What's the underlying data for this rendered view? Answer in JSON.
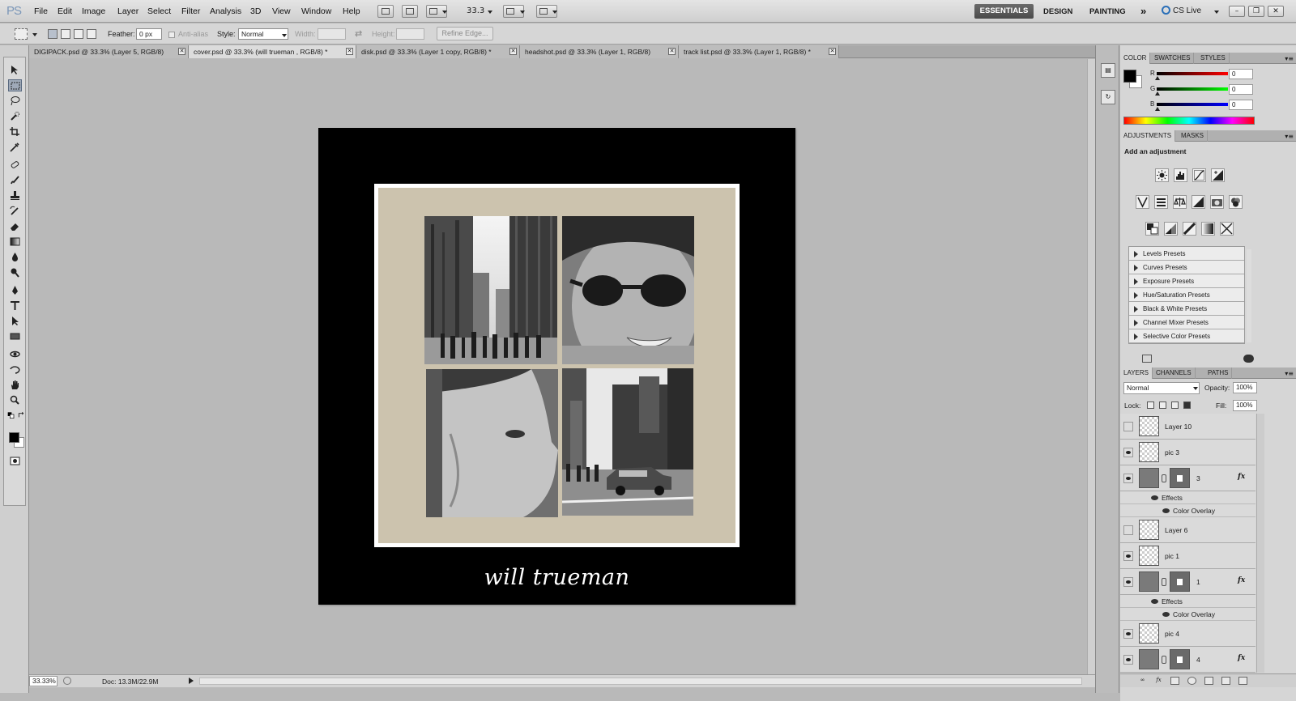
{
  "app": {
    "logo": "PS",
    "menu": [
      "File",
      "Edit",
      "Image",
      "Layer",
      "Select",
      "Filter",
      "Analysis",
      "3D",
      "View",
      "Window",
      "Help"
    ],
    "zoom": "33.3",
    "workspaces": {
      "active": "ESSENTIALS",
      "others": [
        "DESIGN",
        "PAINTING"
      ],
      "more": "»"
    },
    "cs_live": "CS Live"
  },
  "options_bar": {
    "feather_label": "Feather:",
    "feather_value": "0 px",
    "antialias_label": "Anti-alias",
    "style_label": "Style:",
    "style_value": "Normal",
    "width_label": "Width:",
    "height_label": "Height:",
    "refine_edge": "Refine Edge..."
  },
  "tabs": [
    {
      "label": "DIGIPACK.psd @ 33.3% (Layer 5, RGB/8)",
      "active": false
    },
    {
      "label": "cover.psd @ 33.3% (will trueman , RGB/8) *",
      "active": true
    },
    {
      "label": "disk.psd @ 33.3% (Layer 1 copy, RGB/8) *",
      "active": false
    },
    {
      "label": "headshot.psd @ 33.3% (Layer 1, RGB/8)",
      "active": false
    },
    {
      "label": "track list.psd @ 33.3% (Layer 1, RGB/8) *",
      "active": false
    }
  ],
  "document": {
    "title_text": "will trueman",
    "colors": {
      "background": "#000000",
      "frame": "#ffffff",
      "mat": "#ccc3ae"
    }
  },
  "status": {
    "zoom": "33.33%",
    "doc_size": "Doc: 13.3M/22.9M"
  },
  "color_panel": {
    "tabs": [
      "COLOR",
      "SWATCHES",
      "STYLES"
    ],
    "channels": [
      {
        "letter": "R",
        "value": "0",
        "color": "#d00000"
      },
      {
        "letter": "G",
        "value": "0",
        "color": "#00a000"
      },
      {
        "letter": "B",
        "value": "0",
        "color": "#0000d0"
      }
    ]
  },
  "adjustments_panel": {
    "tabs": [
      "ADJUSTMENTS",
      "MASKS"
    ],
    "title": "Add an adjustment",
    "presets": [
      "Levels Presets",
      "Curves Presets",
      "Exposure Presets",
      "Hue/Saturation Presets",
      "Black & White Presets",
      "Channel Mixer Presets",
      "Selective Color Presets"
    ]
  },
  "layers_panel": {
    "tabs": [
      "LAYERS",
      "CHANNELS",
      "PATHS"
    ],
    "blend_mode": "Normal",
    "opacity_label": "Opacity:",
    "opacity": "100%",
    "lock_label": "Lock:",
    "fill_label": "Fill:",
    "fill": "100%",
    "layers": [
      {
        "name": "Layer 10",
        "visible": false,
        "type": "plain"
      },
      {
        "name": "pic 3",
        "visible": true,
        "type": "plain"
      },
      {
        "name": "3",
        "visible": true,
        "type": "masked",
        "fx": "fx",
        "effects_label": "Effects",
        "effect": "Color Overlay"
      },
      {
        "name": "Layer 6",
        "visible": false,
        "type": "plain"
      },
      {
        "name": "pic 1",
        "visible": true,
        "type": "plain"
      },
      {
        "name": "1",
        "visible": true,
        "type": "masked",
        "fx": "fx",
        "effects_label": "Effects",
        "effect": "Color Overlay"
      },
      {
        "name": "pic 4",
        "visible": true,
        "type": "plain"
      },
      {
        "name": "4",
        "visible": true,
        "type": "masked",
        "fx": "fx"
      }
    ]
  }
}
